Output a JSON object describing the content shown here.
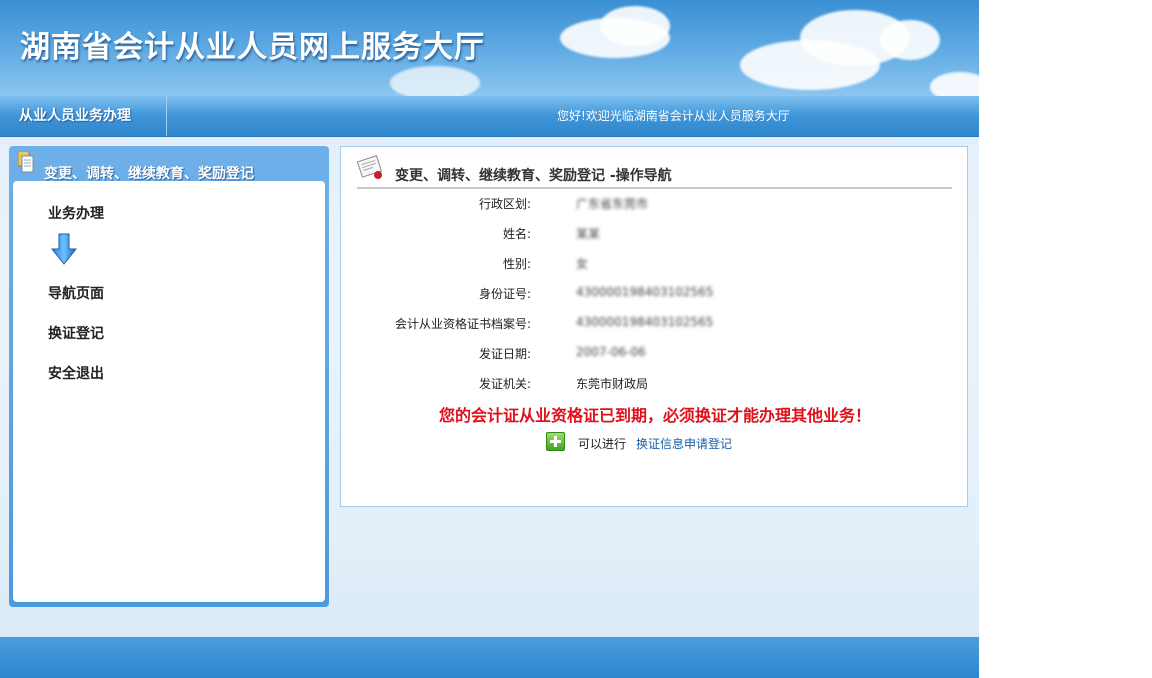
{
  "banner": {
    "title": "湖南省会计从业人员网上服务大厅"
  },
  "navbar": {
    "section_title": "从业人员业务办理",
    "welcome": "您好!欢迎光临湖南省会计从业人员服务大厅"
  },
  "sidebar": {
    "header": "变更、调转、继续教育、奖励登记",
    "items": [
      {
        "label": "业务办理"
      },
      {
        "label": "导航页面"
      },
      {
        "label": "换证登记"
      },
      {
        "label": "安全退出"
      }
    ]
  },
  "main": {
    "title": "变更、调转、继续教育、奖励登记 -操作导航",
    "fields": [
      {
        "label": "行政区划:",
        "value": "广东省东莞市"
      },
      {
        "label": "姓名:",
        "value": "某某"
      },
      {
        "label": "性别:",
        "value": "女"
      },
      {
        "label": "身份证号:",
        "value": "430000198403102565"
      },
      {
        "label": "会计从业资格证书档案号:",
        "value": "430000198403102565"
      },
      {
        "label": "发证日期:",
        "value": "2007-06-06"
      },
      {
        "label": "发证机关:",
        "value": "东莞市财政局"
      }
    ],
    "warning": "您的会计证从业资格证已到期，必须换证才能办理其他业务！",
    "action_prefix": "可以进行",
    "action_link": "换证信息申请登记"
  },
  "colors": {
    "banner": "#4a9ede",
    "warning": "#e0101a",
    "link": "#1a5fa8"
  },
  "icons": {
    "sidebar_header": "document-stack-icon",
    "menu_arrow": "down-arrow-icon",
    "main_header": "certificate-icon",
    "action": "plus-icon"
  }
}
